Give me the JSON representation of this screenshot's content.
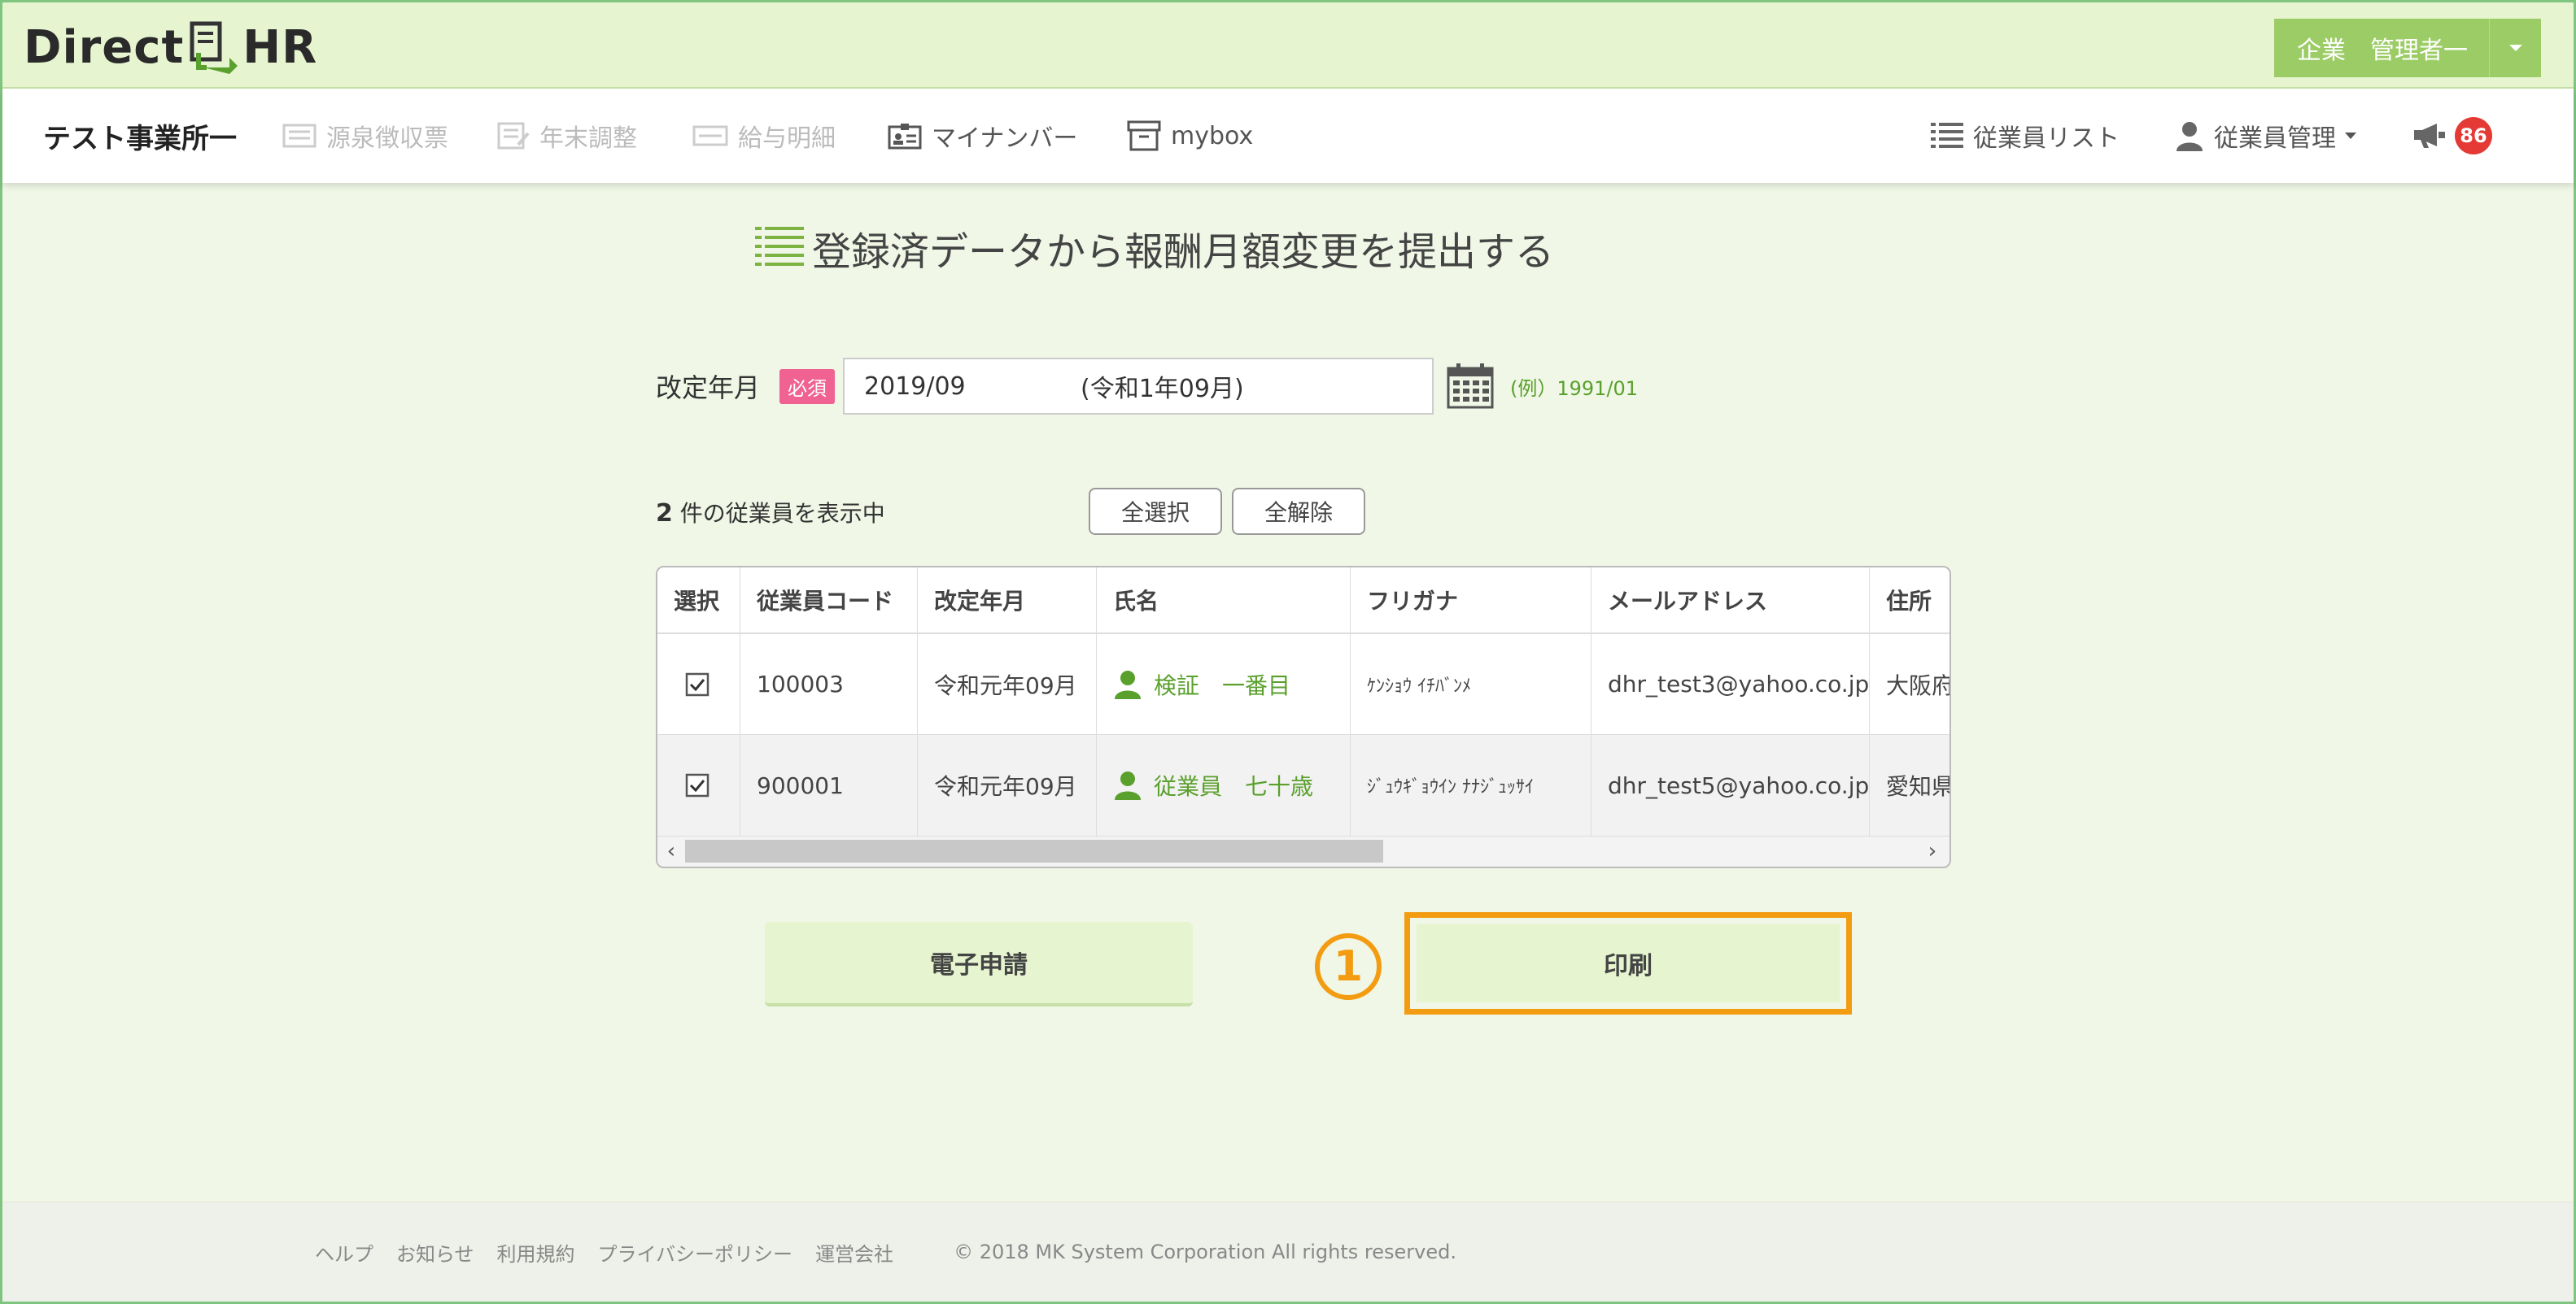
{
  "app": {
    "logo_left": "Direct",
    "logo_right": "HR"
  },
  "user_menu": {
    "label": "企業　管理者一"
  },
  "nav": {
    "office": "テスト事業所一",
    "items": [
      {
        "label": "源泉徴収票",
        "icon": "receipt-icon",
        "enabled": false
      },
      {
        "label": "年末調整",
        "icon": "document-icon",
        "enabled": false
      },
      {
        "label": "給与明細",
        "icon": "payslip-icon",
        "enabled": false
      },
      {
        "label": "マイナンバー",
        "icon": "id-card-icon",
        "enabled": true
      },
      {
        "label": "mybox",
        "icon": "box-icon",
        "enabled": true
      }
    ],
    "right": [
      {
        "label": "従業員リスト",
        "icon": "list-icon"
      },
      {
        "label": "従業員管理",
        "icon": "person-icon"
      }
    ],
    "notification_count": "86"
  },
  "page": {
    "title": "登録済データから報酬月額変更を提出する"
  },
  "form": {
    "label": "改定年月",
    "required_badge": "必須",
    "date_value": "2019/09",
    "era_value": "(令和1年09月)",
    "example": "(例）1991/01"
  },
  "listing": {
    "count": "2",
    "count_text": "件の従業員を表示中",
    "select_all": "全選択",
    "deselect_all": "全解除"
  },
  "table": {
    "headers": [
      "選択",
      "従業員コード",
      "改定年月",
      "氏名",
      "フリガナ",
      "メールアドレス",
      "住所"
    ],
    "rows": [
      {
        "checked": true,
        "code": "100003",
        "revision": "令和元年09月",
        "name": "検証　一番目",
        "kana": "ｹﾝｼｮｳ ｲﾁﾊﾞﾝﾒ",
        "email": "dhr_test3@yahoo.co.jp",
        "address": "大阪府"
      },
      {
        "checked": true,
        "code": "900001",
        "revision": "令和元年09月",
        "name": "従業員　七十歳",
        "kana": "ｼﾞｭｳｷﾞｮｳｲﾝ ﾅﾅｼﾞｭｯｻｲ",
        "email": "dhr_test5@yahoo.co.jp",
        "address": "愛知県"
      }
    ]
  },
  "actions": {
    "electronic": "電子申請",
    "print": "印刷",
    "step_marker": "1"
  },
  "footer": {
    "links": [
      "ヘルプ",
      "お知らせ",
      "利用規約",
      "プライバシーポリシー",
      "運営会社"
    ],
    "copyright": "© 2018 MK System Corporation All rights reserved."
  },
  "colors": {
    "accent_green": "#9ccc65",
    "highlight_orange": "#f39c12",
    "badge_red": "#e53935"
  }
}
